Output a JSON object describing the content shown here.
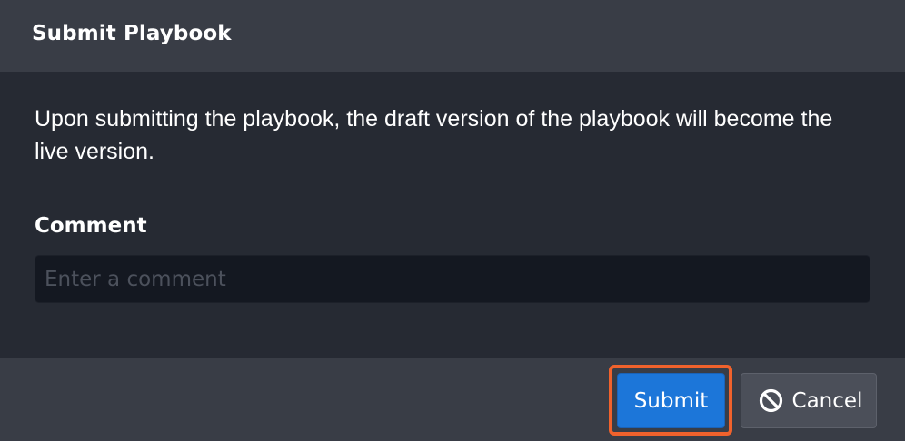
{
  "dialog": {
    "title": "Submit Playbook",
    "message": "Upon submitting the playbook, the draft version of the playbook will become the live version.",
    "comment": {
      "label": "Comment",
      "placeholder": "Enter a comment",
      "value": ""
    },
    "buttons": {
      "submit_label": "Submit",
      "cancel_label": "Cancel",
      "cancel_icon": "cancel-circle-slash-icon"
    }
  },
  "colors": {
    "header_bg": "#393d46",
    "body_bg": "#262a33",
    "input_bg": "#141821",
    "submit_bg": "#1c76d9",
    "cancel_bg": "#4b4f59",
    "highlight": "#f0622c"
  }
}
